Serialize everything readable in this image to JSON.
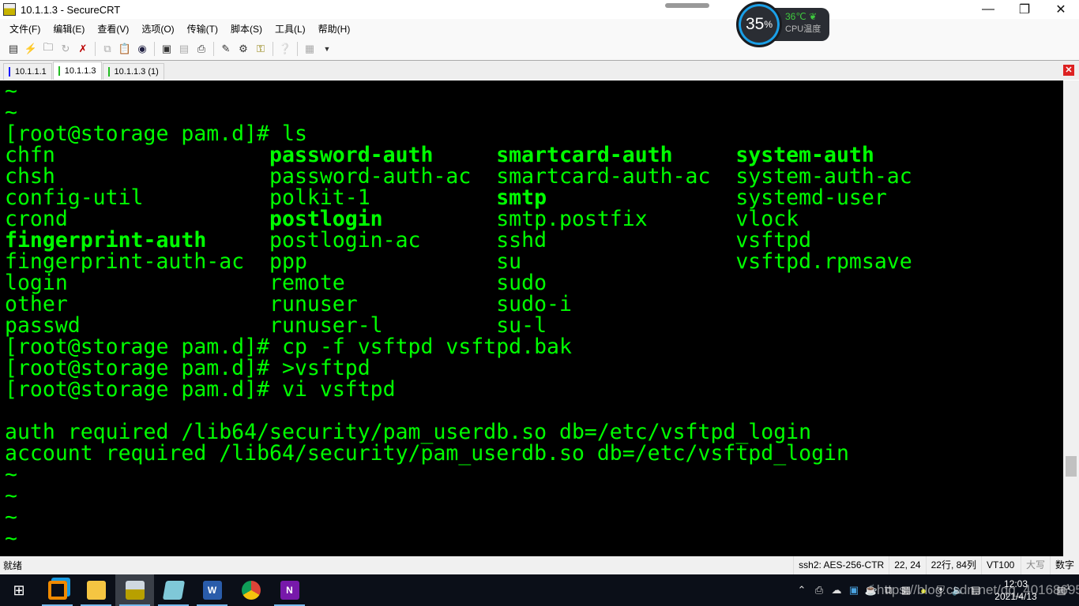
{
  "window": {
    "title": "10.1.1.3 - SecureCRT"
  },
  "menu": [
    "文件(F)",
    "编辑(E)",
    "查看(V)",
    "选项(O)",
    "传输(T)",
    "脚本(S)",
    "工具(L)",
    "帮助(H)"
  ],
  "tabs": [
    {
      "label": "10.1.1.1",
      "color": "#1a1aff",
      "active": false
    },
    {
      "label": "10.1.1.3",
      "color": "#22bb22",
      "active": true
    },
    {
      "label": "10.1.1.3 (1)",
      "color": "#22bb22",
      "active": false
    }
  ],
  "cpu_widget": {
    "percent": "35",
    "unit": "%",
    "temp": "36℃",
    "label": "CPU温度"
  },
  "terminal": {
    "pre": [
      "~",
      "~",
      "[root@storage pam.d]# ls"
    ],
    "ls": [
      [
        {
          "t": "chfn",
          "b": false
        },
        {
          "t": "password-auth",
          "b": true
        },
        {
          "t": "smartcard-auth",
          "b": true
        },
        {
          "t": "system-auth",
          "b": true
        }
      ],
      [
        {
          "t": "chsh",
          "b": false
        },
        {
          "t": "password-auth-ac",
          "b": false
        },
        {
          "t": "smartcard-auth-ac",
          "b": false
        },
        {
          "t": "system-auth-ac",
          "b": false
        }
      ],
      [
        {
          "t": "config-util",
          "b": false
        },
        {
          "t": "polkit-1",
          "b": false
        },
        {
          "t": "smtp",
          "b": true
        },
        {
          "t": "systemd-user",
          "b": false
        }
      ],
      [
        {
          "t": "crond",
          "b": false
        },
        {
          "t": "postlogin",
          "b": true
        },
        {
          "t": "smtp.postfix",
          "b": false
        },
        {
          "t": "vlock",
          "b": false
        }
      ],
      [
        {
          "t": "fingerprint-auth",
          "b": true
        },
        {
          "t": "postlogin-ac",
          "b": false
        },
        {
          "t": "sshd",
          "b": false
        },
        {
          "t": "vsftpd",
          "b": false
        }
      ],
      [
        {
          "t": "fingerprint-auth-ac",
          "b": false
        },
        {
          "t": "ppp",
          "b": false
        },
        {
          "t": "su",
          "b": false
        },
        {
          "t": "vsftpd.rpmsave",
          "b": false
        }
      ],
      [
        {
          "t": "login",
          "b": false
        },
        {
          "t": "remote",
          "b": false
        },
        {
          "t": "sudo",
          "b": false
        },
        {
          "t": "",
          "b": false
        }
      ],
      [
        {
          "t": "other",
          "b": false
        },
        {
          "t": "runuser",
          "b": false
        },
        {
          "t": "sudo-i",
          "b": false
        },
        {
          "t": "",
          "b": false
        }
      ],
      [
        {
          "t": "passwd",
          "b": false
        },
        {
          "t": "runuser-l",
          "b": false
        },
        {
          "t": "su-l",
          "b": false
        },
        {
          "t": "",
          "b": false
        }
      ]
    ],
    "post": [
      "[root@storage pam.d]# cp -f vsftpd vsftpd.bak",
      "[root@storage pam.d]# >vsftpd",
      "[root@storage pam.d]# vi vsftpd",
      "",
      "auth required /lib64/security/pam_userdb.so db=/etc/vsftpd_login",
      "account required /lib64/security/pam_userdb.so db=/etc/vsftpd_login",
      "~",
      "~",
      "~",
      "~"
    ]
  },
  "status": {
    "ready": "就绪",
    "cipher": "ssh2: AES-256-CTR",
    "cursor": "22,  24",
    "size": "22行, 84列",
    "emulation": "VT100",
    "caps": "大写",
    "num": "数字"
  },
  "taskbar": {
    "time": "12:03",
    "date": "2021/4/13",
    "notification_count": "1",
    "apps": [
      "vmware-workstation",
      "file-explorer",
      "securecrt",
      "notepad",
      "word",
      "chrome",
      "onenote"
    ]
  },
  "watermark": "https://blog.csdn.net/qq_40168695"
}
